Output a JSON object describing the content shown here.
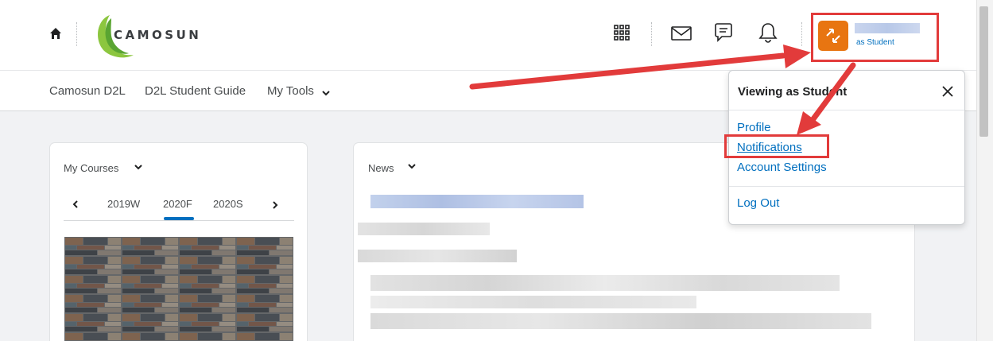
{
  "header": {
    "logo_text": "CAMOSUN",
    "user_role": "as Student"
  },
  "navbar": {
    "links": [
      "Camosun D2L",
      "D2L Student Guide",
      "My Tools"
    ]
  },
  "courses_widget": {
    "title": "My Courses",
    "tabs": [
      "2019W",
      "2020F",
      "2020S"
    ],
    "selected_tab": "2020F"
  },
  "news_widget": {
    "title": "News"
  },
  "user_menu": {
    "title": "Viewing as Student",
    "items": [
      "Profile",
      "Notifications",
      "Account Settings",
      "Log Out"
    ],
    "highlighted_item": "Notifications"
  },
  "colors": {
    "accent": "#006fbf",
    "avatar": "#e87511",
    "annotation": "#e23b3b",
    "logo_green": "#8cc63f"
  },
  "icons": [
    "home-icon",
    "waffle-grid-icon",
    "mail-icon",
    "chat-icon",
    "bell-icon",
    "role-switch-icon",
    "chevron-down-icon",
    "close-icon",
    "chevron-left-icon",
    "chevron-right-icon"
  ]
}
